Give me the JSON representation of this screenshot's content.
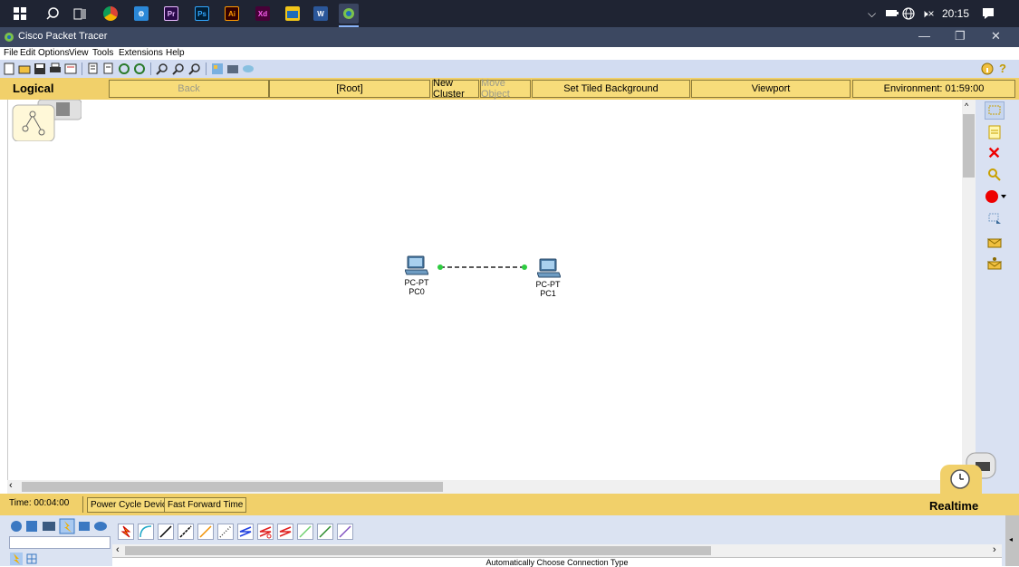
{
  "taskbar": {
    "time": "20:15",
    "apps": [
      "start-icon",
      "search-icon",
      "task-view-icon",
      "chrome-icon",
      "app-icon",
      "Pr",
      "Ps",
      "Ai",
      "Xd",
      "file-explorer-icon",
      "W",
      "packet-tracer-icon"
    ]
  },
  "window": {
    "title": "Cisco Packet Tracer"
  },
  "menu": [
    "File",
    "Edit",
    "Options",
    "View",
    "Tools",
    "Extensions",
    "Help"
  ],
  "logical_bar": {
    "mode": "Logical",
    "back": "Back",
    "root": "[Root]",
    "new_cluster": "New Cluster",
    "move_object": "Move Object",
    "tiled_bg": "Set Tiled Background",
    "viewport": "Viewport",
    "environment": "Environment: 01:59:00"
  },
  "devices": [
    {
      "model": "PC-PT",
      "name": "PC0"
    },
    {
      "model": "PC-PT",
      "name": "PC1"
    }
  ],
  "status_bar": {
    "time": "Time: 00:04:00",
    "power_cycle": "Power Cycle Devices",
    "fast_forward": "Fast Forward Time",
    "realtime": "Realtime"
  },
  "connection": {
    "label": "Automatically Choose Connection Type"
  },
  "colors": {
    "accent_bar": "#f1d06a",
    "taskbar": "#1f2433",
    "titlebar": "#3c4861",
    "toolbar": "#d2dcf1"
  }
}
